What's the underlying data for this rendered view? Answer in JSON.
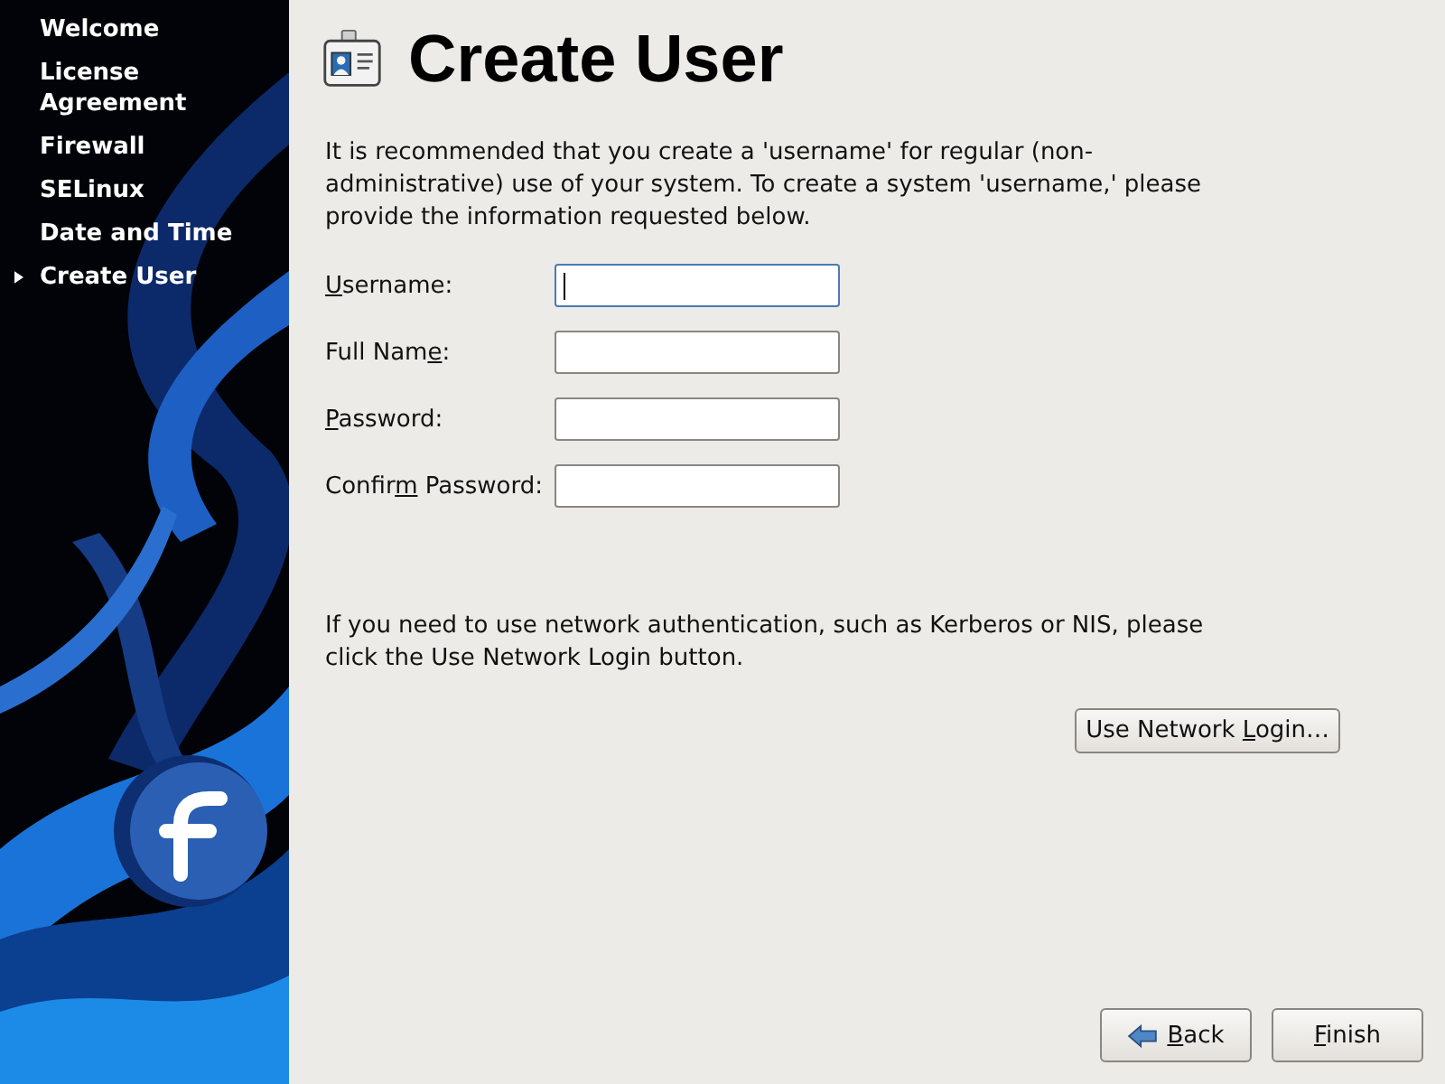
{
  "sidebar": {
    "items": [
      {
        "label": "Welcome",
        "selected": false
      },
      {
        "label": "License Agreement",
        "selected": false
      },
      {
        "label": "Firewall",
        "selected": false
      },
      {
        "label": "SELinux",
        "selected": false
      },
      {
        "label": "Date and Time",
        "selected": false
      },
      {
        "label": "Create User",
        "selected": true
      }
    ]
  },
  "page": {
    "title": "Create User",
    "intro": "It is recommended that you create a 'username' for regular (non-administrative) use of your system. To create a system 'username,' please provide the information requested below.",
    "fields": [
      {
        "label": [
          {
            "text": "U",
            "underline": true
          },
          {
            "text": "sername:",
            "underline": false
          }
        ],
        "focused": true
      },
      {
        "label": [
          {
            "text": "Full Nam",
            "underline": false
          },
          {
            "text": "e",
            "underline": true
          },
          {
            "text": ":",
            "underline": false
          }
        ],
        "focused": false
      },
      {
        "label": [
          {
            "text": "P",
            "underline": true
          },
          {
            "text": "assword:",
            "underline": false
          }
        ],
        "focused": false
      },
      {
        "label": [
          {
            "text": "Confir",
            "underline": false
          },
          {
            "text": "m",
            "underline": true
          },
          {
            "text": " Password:",
            "underline": false
          }
        ],
        "focused": false
      }
    ],
    "network_note": "If you need to use network authentication, such as Kerberos or NIS, please click the Use Network Login button.",
    "network_button": {
      "label": [
        {
          "text": "Use Network ",
          "underline": false
        },
        {
          "text": "L",
          "underline": true
        },
        {
          "text": "ogin…",
          "underline": false
        }
      ]
    }
  },
  "buttons": [
    {
      "kind": "back",
      "label": [
        {
          "text": "B",
          "underline": true
        },
        {
          "text": "ack",
          "underline": false
        }
      ]
    },
    {
      "kind": "finish",
      "label": [
        {
          "text": "F",
          "underline": true
        },
        {
          "text": "inish",
          "underline": false
        }
      ]
    }
  ]
}
